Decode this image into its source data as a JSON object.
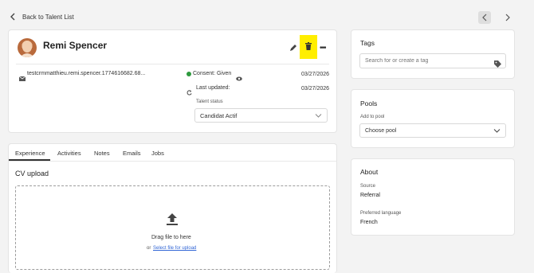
{
  "nav": {
    "back_label": "Back to Talent List"
  },
  "profile": {
    "name": "Remi Spencer",
    "email": "testcrmmatthieu.remi.spencer.1774616682.68...",
    "email_date": "03/27/2026",
    "consent_label": "Consent:",
    "consent_value": "Given",
    "last_updated_label": "Last updated:",
    "last_updated_date": "03/27/2026",
    "talent_status_label": "Talent status",
    "talent_status_value": "Candidat Actif"
  },
  "tabs": [
    "Experience",
    "Activities",
    "Notes",
    "Emails",
    "Jobs"
  ],
  "cv": {
    "title": "CV upload",
    "drag_text": "Drag file to here",
    "or_text": "or",
    "select_link": "Select file for upload"
  },
  "tags": {
    "title": "Tags",
    "placeholder": "Search for or create a tag"
  },
  "pools": {
    "title": "Pools",
    "add_label": "Add to pool",
    "select_value": "Choose pool"
  },
  "about": {
    "title": "About",
    "source_label": "Source",
    "source_value": "Referral",
    "language_label": "Preferred language",
    "language_value": "French"
  },
  "colors": {
    "highlight": "#ffee00",
    "consent": "#2e9a3e",
    "accent": "#3367d6"
  }
}
